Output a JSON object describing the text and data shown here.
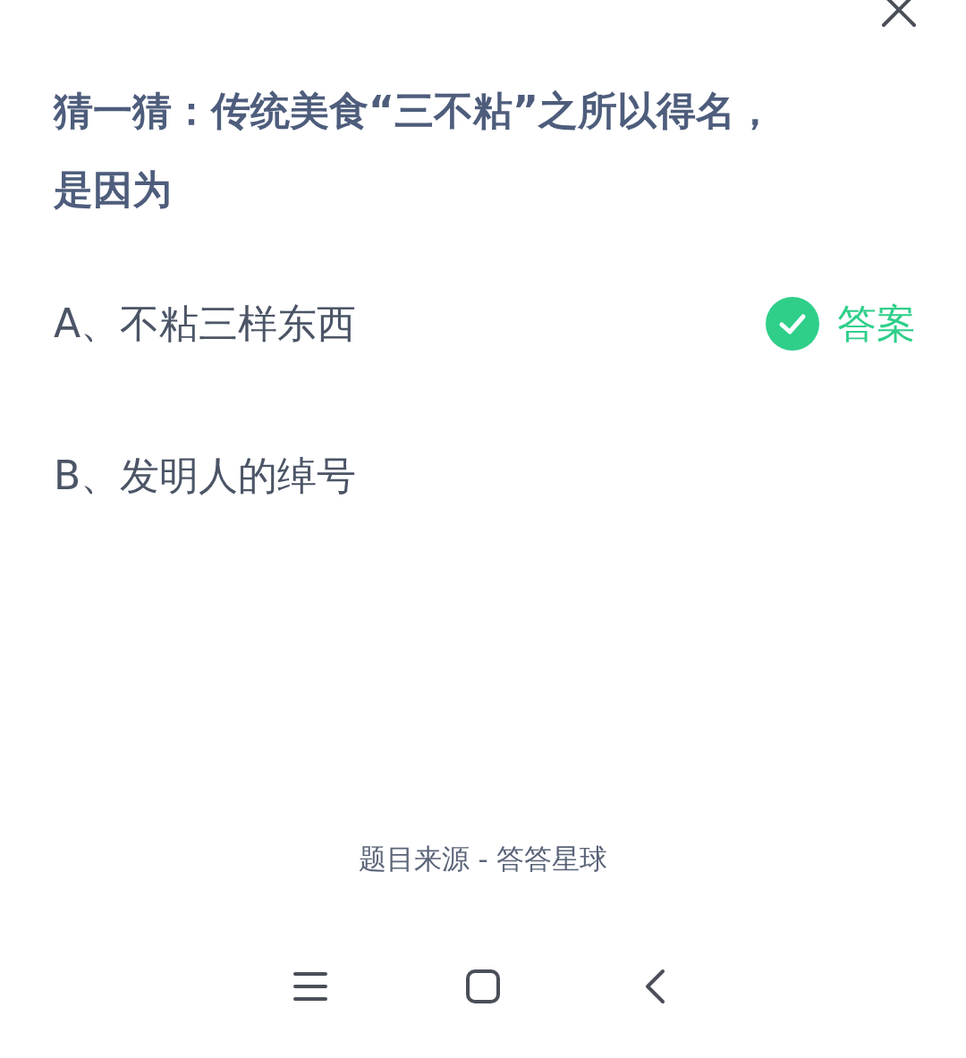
{
  "question": {
    "title": "猜一猜：传统美食“三不粘”之所以得名，是因为"
  },
  "answer_badge": "答案",
  "options": [
    {
      "label": "A、不粘三样东西",
      "is_answer": true
    },
    {
      "label": "B、发明人的绰号",
      "is_answer": false
    }
  ],
  "footer": "题目来源 - 答答星球"
}
